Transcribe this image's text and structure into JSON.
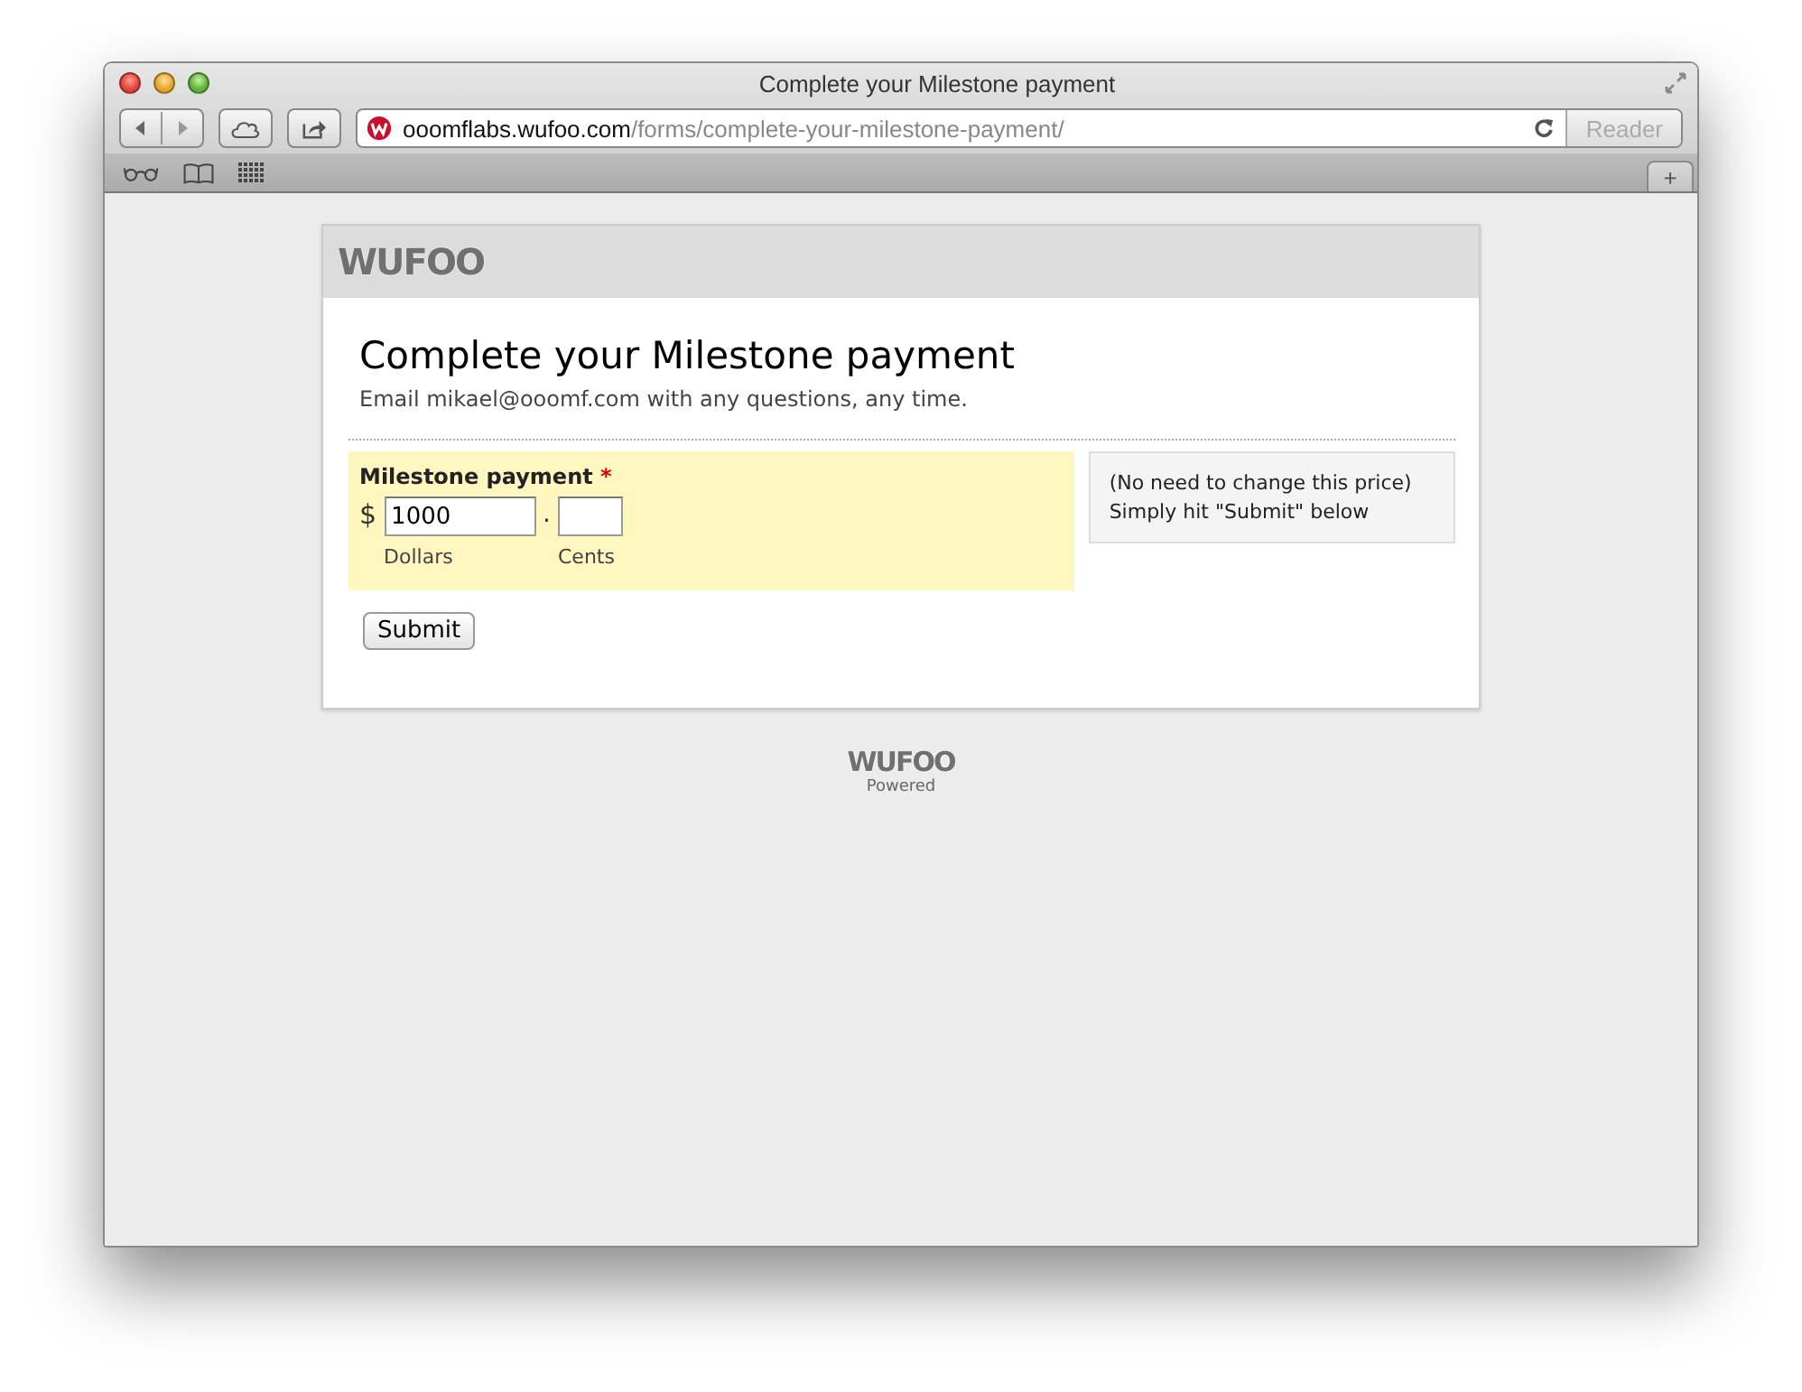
{
  "window": {
    "title": "Complete your Milestone payment"
  },
  "address_bar": {
    "domain": "ooomflabs.wufoo.com",
    "path": "/forms/complete-your-milestone-payment/"
  },
  "reader_button": {
    "label": "Reader",
    "disabled": true
  },
  "new_tab_button": {
    "label": "+"
  },
  "form": {
    "logo": "WUFOO",
    "title": "Complete your Milestone payment",
    "description": "Email mikael@ooomf.com with any questions, any time.",
    "field": {
      "label": "Milestone payment",
      "required_mark": "*",
      "currency": "$",
      "separator": ".",
      "highlighted": true,
      "dollars": {
        "value": "1000",
        "sublabel": "Dollars"
      },
      "cents": {
        "sublabel": "Cents"
      }
    },
    "instructions": [
      "(No need to change this price)",
      "Simply hit \"Submit\" below"
    ],
    "submit": "Submit"
  },
  "footer": {
    "logo": "WUFOO",
    "caption": "Powered"
  }
}
